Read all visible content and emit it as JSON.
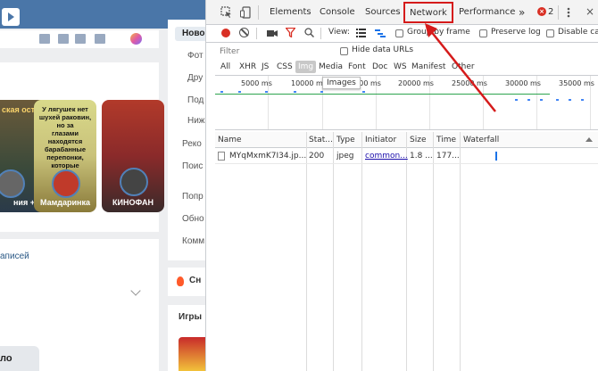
{
  "vk": {
    "stories": [
      {
        "caption": "ская\nость",
        "name": "ния +"
      },
      {
        "caption": "У лягушек нет\nшухей раковин,\nно за\nглазами\nнаходятся\nбарабанные\nперепонки,\nкоторые",
        "name": "Мамдаринка"
      },
      {
        "caption": "",
        "name": "КИНОФАН"
      }
    ],
    "posts_label": "аписей",
    "bottom_label": "ло",
    "menu_items": [
      "Ново",
      "Фот",
      "Дру",
      "Под",
      "Ниж",
      "Реко",
      "Поис",
      "Попр",
      "Обно",
      "Комм"
    ],
    "sn_label": "Сн",
    "games_label": "Игры",
    "colors": {
      "header": "#4a76a8",
      "link": "#2a5885"
    }
  },
  "devtools": {
    "tabs": [
      "Elements",
      "Console",
      "Sources",
      "Network",
      "Performance"
    ],
    "more_tabs": "»",
    "error_count": "2",
    "toolbar": {
      "view_label": "View:",
      "group_by_frame": "Group by frame",
      "preserve_log": "Preserve log",
      "disable_cache": "Disable cac"
    },
    "filter": {
      "placeholder": "Filter",
      "hide_data_urls": "Hide data URLs"
    },
    "type_filters": [
      "All",
      "XHR",
      "JS",
      "CSS",
      "Img",
      "Media",
      "Font",
      "Doc",
      "WS",
      "Manifest",
      "Other"
    ],
    "active_type": "Img",
    "tooltip": "Images",
    "overview_ticks": [
      "5000 ms",
      "10000 ms",
      "15000 ms",
      "20000 ms",
      "25000 ms",
      "30000 ms",
      "35000 ms"
    ],
    "columns": [
      "Name",
      "Stat...",
      "Type",
      "Initiator",
      "Size",
      "Time",
      "Waterfall"
    ],
    "rows": [
      {
        "name": "MYqMxmK7I34.jp...",
        "status": "200",
        "type": "jpeg",
        "initiator": "common...",
        "size": "1.8 ...",
        "time": "177..."
      }
    ],
    "colors": {
      "record": "#d93025",
      "annotation": "#d51b1b",
      "accent": "#1a73e8"
    }
  }
}
